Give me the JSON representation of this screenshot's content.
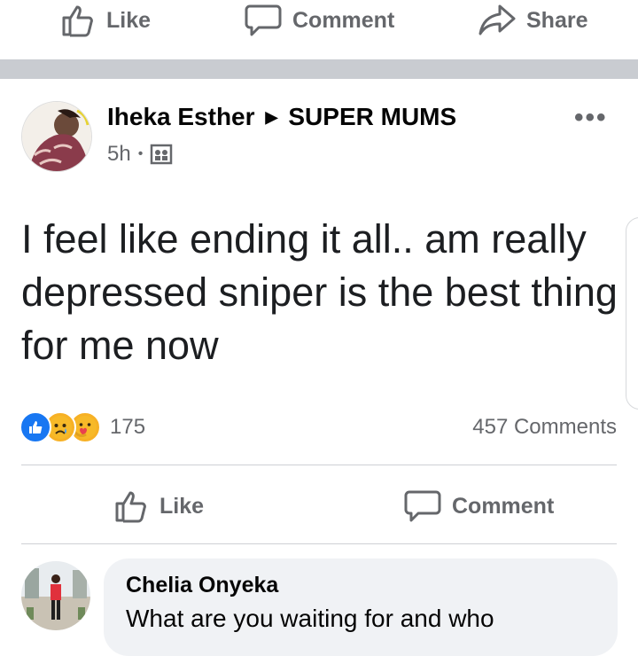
{
  "top_actions": {
    "like": "Like",
    "comment": "Comment",
    "share": "Share"
  },
  "post": {
    "author": "Iheka Esther",
    "group": "SUPER  MUMS",
    "time": "5h",
    "separator": "•",
    "more": "•••",
    "text": "I feel like ending it all.. am really depressed  sniper is the best thing for me now",
    "reaction_count": "175",
    "comment_count": "457 Comments",
    "reactions": [
      "like-icon",
      "sad-icon",
      "care-icon"
    ]
  },
  "post_actions": {
    "like": "Like",
    "comment": "Comment"
  },
  "comment": {
    "name": "Chelia Onyeka",
    "text": "What are you waiting for and who"
  },
  "colors": {
    "like_blue": "#1877f2",
    "muted": "#65676b",
    "band": "#c9ccd1",
    "bubble": "#f0f2f5"
  }
}
